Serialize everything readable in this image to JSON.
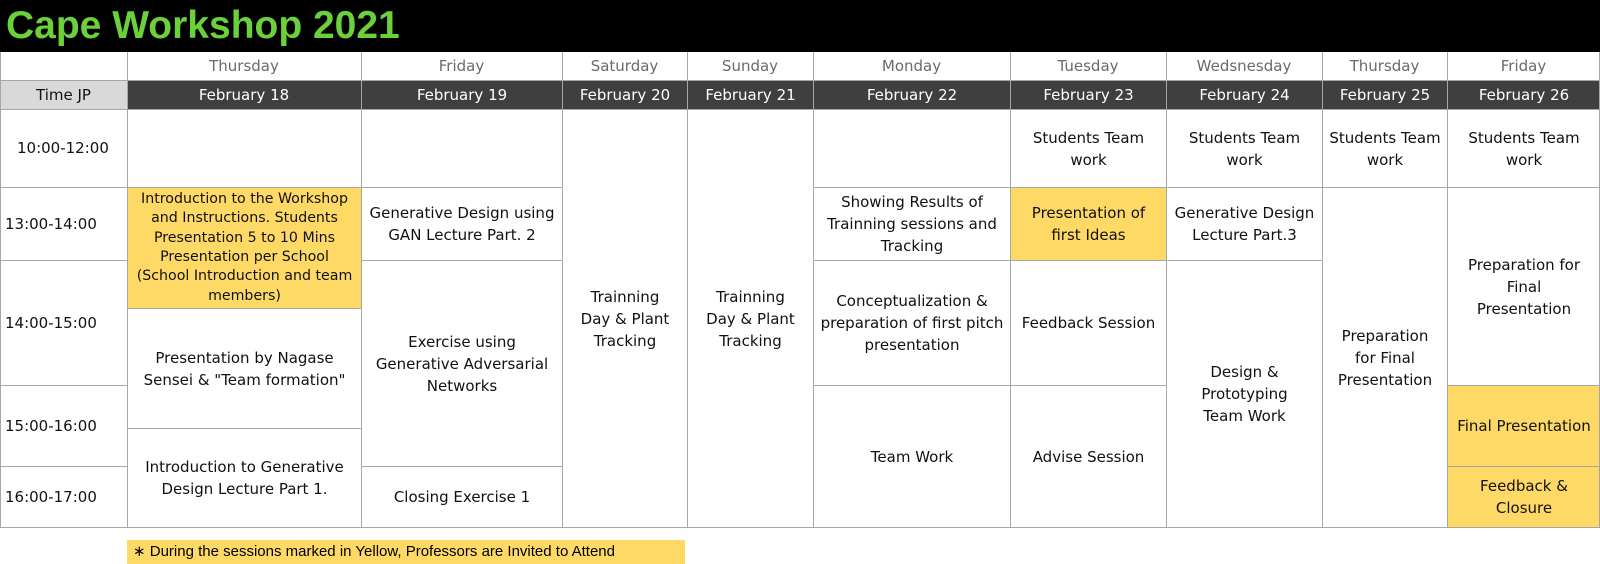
{
  "title": "Cape Workshop 2021",
  "colors": {
    "title_bg": "#000000",
    "title_text": "#6bd13a",
    "date_header_bg": "#3f3f3f",
    "time_header_bg": "#d9d9d9",
    "highlight_yellow": "#ffd966"
  },
  "header": {
    "time_label": "Time  JP",
    "days": [
      "Thursday",
      "Friday",
      "Saturday",
      "Sunday",
      "Monday",
      "Tuesday",
      "Wedsnesday",
      "Thursday",
      "Friday"
    ],
    "dates": [
      "February 18",
      "February 19",
      "February 20",
      "February 21",
      "February 22",
      "February 23",
      "February 24",
      "February 25",
      "February 26"
    ]
  },
  "times": [
    "10:00-12:00",
    "13:00-14:00",
    "14:00-15:00",
    "15:00-16:00",
    "16:00-17:00"
  ],
  "sessions": {
    "feb18": [
      {
        "text": "Introduction to the Workshop and Instructions.  Students Presentation 5 to 10 Mins Presentation per School (School Introduction and team members)",
        "highlight": true
      },
      {
        "text": "Presentation by Nagase Sensei &  \"Team formation\"",
        "highlight": false
      },
      {
        "text": "Introduction to Generative Design Lecture Part 1.",
        "highlight": false
      }
    ],
    "feb19": [
      {
        "text": "Generative Design using GAN Lecture Part. 2",
        "highlight": false
      },
      {
        "text": "Exercise using Generative Adversarial Networks",
        "highlight": false
      },
      {
        "text": "Closing Exercise 1",
        "highlight": false
      }
    ],
    "feb20": [
      {
        "text": "Trainning Day  &  Plant Tracking",
        "highlight": false
      }
    ],
    "feb21": [
      {
        "text": "Trainning Day  &  Plant Tracking",
        "highlight": false
      }
    ],
    "feb22": [
      {
        "text": "Showing Results of Trainning sessions and Tracking",
        "highlight": false
      },
      {
        "text": "Conceptualization & preparation of first pitch presentation",
        "highlight": false
      },
      {
        "text": "Team Work",
        "highlight": false
      }
    ],
    "feb23": [
      {
        "text": "Students Team work",
        "highlight": false
      },
      {
        "text": "Presentation of first Ideas",
        "highlight": true
      },
      {
        "text": "Feedback Session",
        "highlight": false
      },
      {
        "text": "Advise Session",
        "highlight": false
      }
    ],
    "feb24": [
      {
        "text": "Students Team work",
        "highlight": false
      },
      {
        "text": "Generative Design Lecture Part.3",
        "highlight": false
      },
      {
        "text": "Design & Prototyping Team Work",
        "highlight": false
      }
    ],
    "feb25": [
      {
        "text": "Students Team work",
        "highlight": false
      },
      {
        "text": "Preparation for Final Presentation",
        "highlight": false
      }
    ],
    "feb26": [
      {
        "text": "Students Team work",
        "highlight": false
      },
      {
        "text": "Preparation for Final Presentation",
        "highlight": false
      },
      {
        "text": "Final Presentation",
        "highlight": true
      },
      {
        "text": "Feedback & Closure",
        "highlight": true
      }
    ]
  },
  "note": "∗ During the sessions marked in Yellow, Professors are Invited to Attend"
}
